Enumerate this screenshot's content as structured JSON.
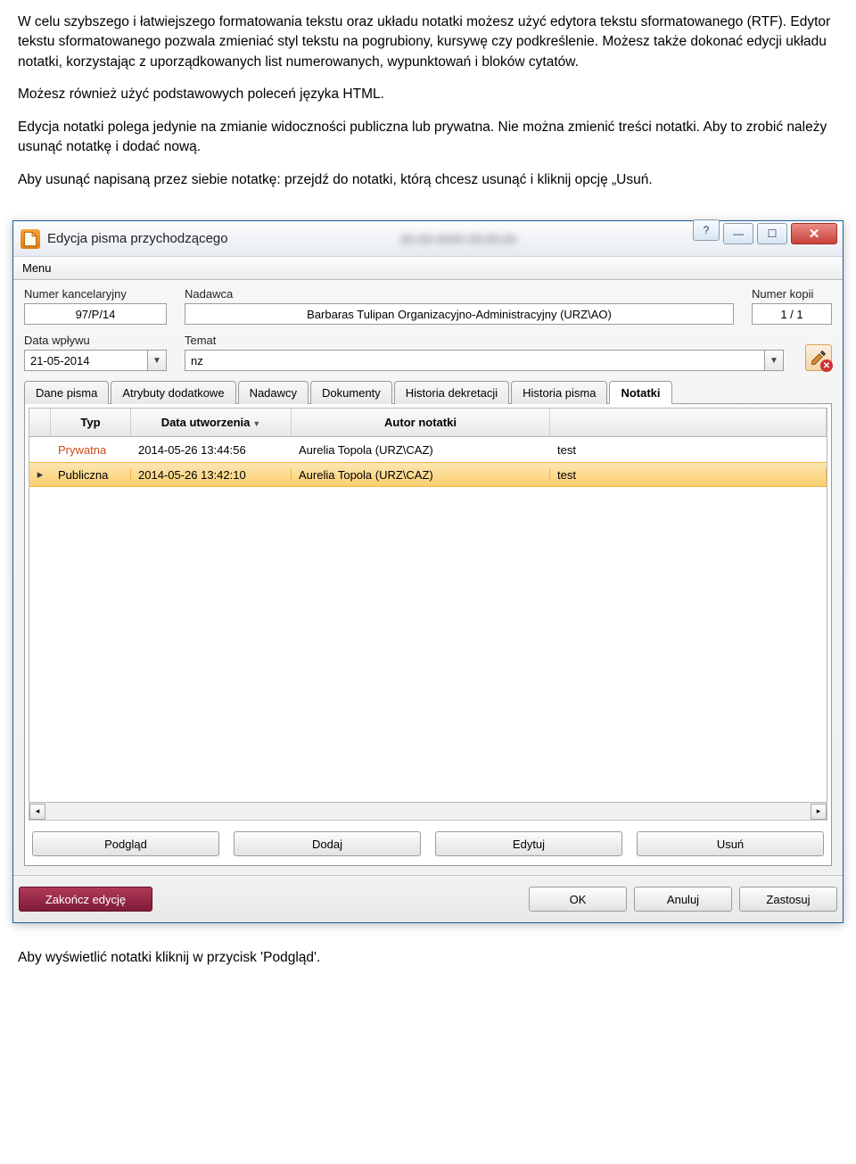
{
  "doc": {
    "p1": "W celu szybszego i łatwiejszego formatowania tekstu oraz układu notatki możesz użyć edytora tekstu sformatowanego (RTF). Edytor tekstu sformatowanego pozwala zmieniać styl tekstu na pogrubiony, kursywę czy podkreślenie. Możesz także dokonać edycji układu notatki, korzystając z uporządkowanych list numerowanych, wypunktowań i bloków cytatów.",
    "p2": "Możesz również użyć podstawowych poleceń języka HTML.",
    "p3": "Edycja notatki polega jedynie na zmianie widoczności publiczna lub prywatna. Nie można zmienić treści notatki. Aby to zrobić należy usunąć notatkę i dodać nową.",
    "p4": "Aby usunąć napisaną przez siebie notatkę: przejdź do notatki, którą chcesz usunąć i kliknij opcję „Usuń.",
    "p5": "Aby wyświetlić notatki kliknij w przycisk 'Podgląd'."
  },
  "window": {
    "title": "Edycja pisma przychodzącego"
  },
  "menubar": {
    "item": "Menu"
  },
  "fields": {
    "numer_label": "Numer kancelaryjny",
    "numer_value": "97/P/14",
    "nadawca_label": "Nadawca",
    "nadawca_value": "Barbaras Tulipan Organizacyjno-Administracyjny (URZ\\AO)",
    "kopii_label": "Numer kopii",
    "kopii_value": "1 / 1",
    "data_label": "Data wpływu",
    "data_value": "21-05-2014",
    "temat_label": "Temat",
    "temat_value": "nz"
  },
  "tabs": {
    "t0": "Dane pisma",
    "t1": "Atrybuty dodatkowe",
    "t2": "Nadawcy",
    "t3": "Dokumenty",
    "t4": "Historia dekretacji",
    "t5": "Historia pisma",
    "t6": "Notatki"
  },
  "grid": {
    "h_typ": "Typ",
    "h_data": "Data utworzenia",
    "h_autor": "Autor notatki",
    "rows": {
      "r0": {
        "typ": "Prywatna",
        "date": "2014-05-26 13:44:56",
        "author": "Aurelia Topola (URZ\\CAZ)",
        "rest": "test"
      },
      "r1": {
        "typ": "Publiczna",
        "date": "2014-05-26 13:42:10",
        "author": "Aurelia Topola (URZ\\CAZ)",
        "rest": "test"
      }
    }
  },
  "panel_buttons": {
    "b0": "Podgląd",
    "b1": "Dodaj",
    "b2": "Edytuj",
    "b3": "Usuń"
  },
  "footer": {
    "end": "Zakończ edycję",
    "ok": "OK",
    "cancel": "Anuluj",
    "apply": "Zastosuj"
  }
}
